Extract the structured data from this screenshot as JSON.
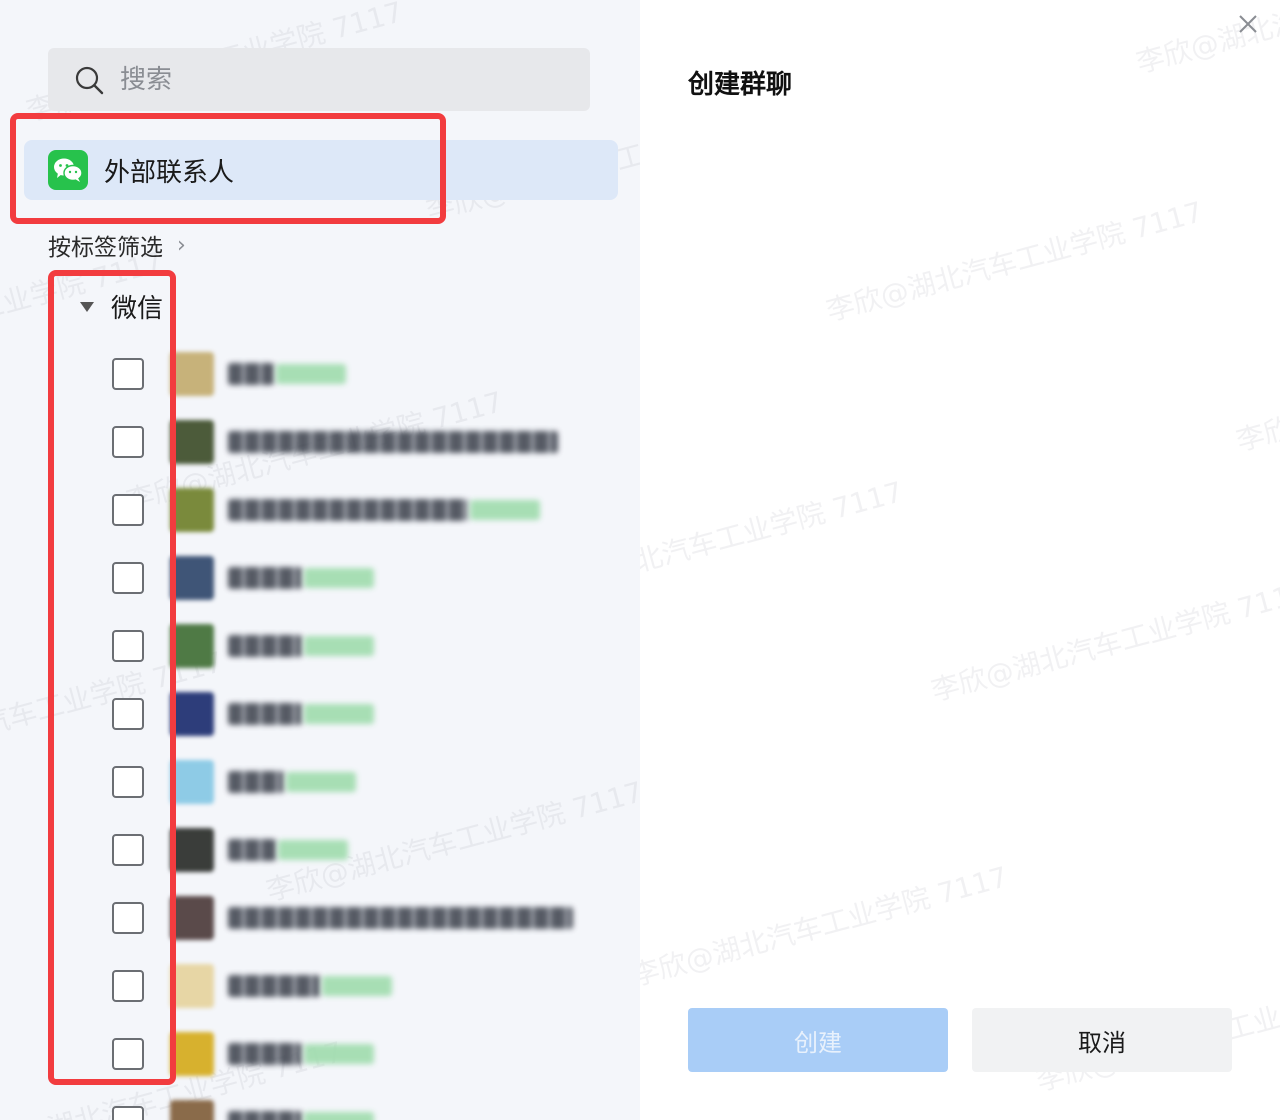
{
  "search": {
    "placeholder": "搜索"
  },
  "source": {
    "label": "外部联系人",
    "icon": "wechat-icon",
    "accent": "#27c24c"
  },
  "filter": {
    "label": "按标签筛选",
    "chevron": "›"
  },
  "group": {
    "label": "微信",
    "expanded": true
  },
  "contacts": [
    {
      "checked": false,
      "avatar_color": "#c7b27a",
      "name_color": "#3a3f4a",
      "name_len": 46,
      "tag_len": 70
    },
    {
      "checked": false,
      "avatar_color": "#4c5b3a",
      "name_color": "#3a3f4a",
      "name_len": 330,
      "tag_len": 0
    },
    {
      "checked": false,
      "avatar_color": "#7a8a3c",
      "name_color": "#3a3f4a",
      "name_len": 240,
      "tag_len": 70
    },
    {
      "checked": false,
      "avatar_color": "#3f5577",
      "name_color": "#3a3f4a",
      "name_len": 74,
      "tag_len": 70
    },
    {
      "checked": false,
      "avatar_color": "#4f7a45",
      "name_color": "#3a3f4a",
      "name_len": 74,
      "tag_len": 70
    },
    {
      "checked": false,
      "avatar_color": "#2d3d7a",
      "name_color": "#3a3f4a",
      "name_len": 74,
      "tag_len": 70
    },
    {
      "checked": false,
      "avatar_color": "#8ecbe6",
      "name_color": "#3a3f4a",
      "name_len": 56,
      "tag_len": 70
    },
    {
      "checked": false,
      "avatar_color": "#3a3d3a",
      "name_color": "#3a3f4a",
      "name_len": 48,
      "tag_len": 70
    },
    {
      "checked": false,
      "avatar_color": "#5a4a4a",
      "name_color": "#3a3f4a",
      "name_len": 345,
      "tag_len": 0
    },
    {
      "checked": false,
      "avatar_color": "#e7d6a5",
      "name_color": "#3a3f4a",
      "name_len": 92,
      "tag_len": 70
    },
    {
      "checked": false,
      "avatar_color": "#d7b12e",
      "name_color": "#3a3f4a",
      "name_len": 74,
      "tag_len": 70
    },
    {
      "checked": false,
      "avatar_color": "#8a6b4a",
      "name_color": "#3a3f4a",
      "name_len": 74,
      "tag_len": 70
    }
  ],
  "dialog": {
    "title": "创建群聊",
    "close": "close-icon"
  },
  "buttons": {
    "create": "创建",
    "cancel": "取消"
  },
  "watermark": "李欣@湖北汽车工业学院 7117",
  "annotation_color": "#f23c3f"
}
